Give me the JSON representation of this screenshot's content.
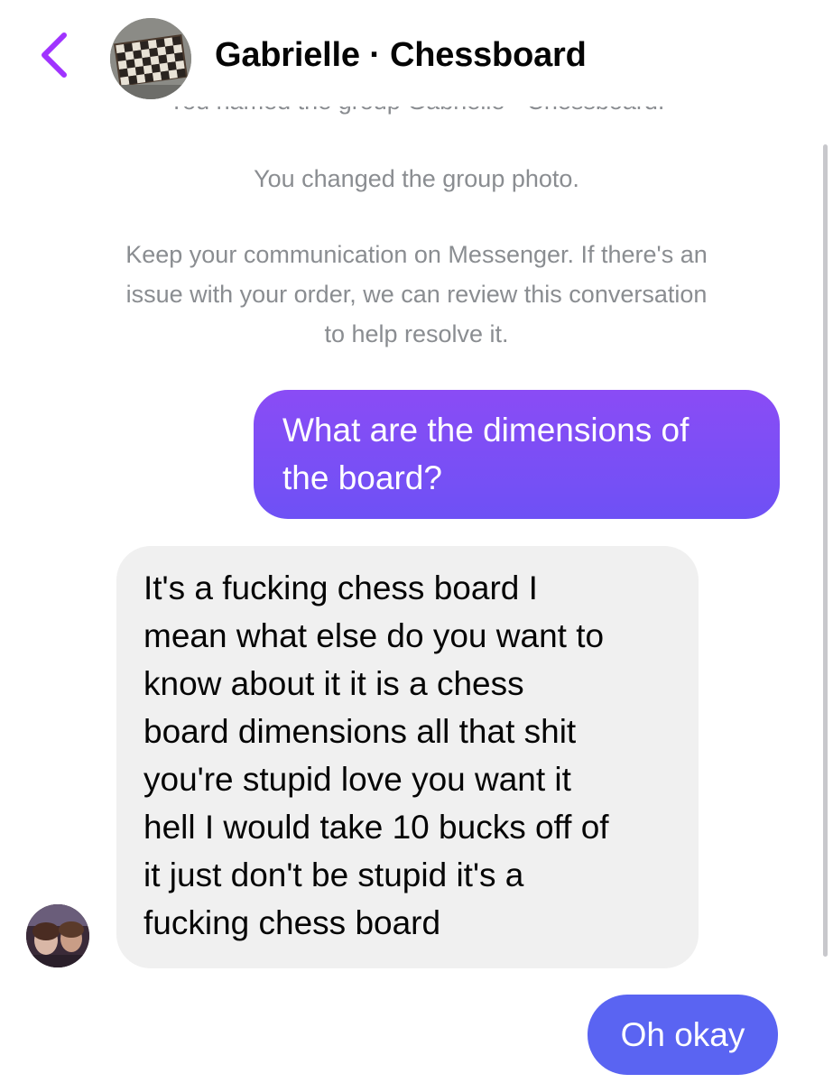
{
  "header": {
    "title": "Gabrielle · Chessboard",
    "back_icon": "chevron-left-icon",
    "avatar_icon": "chessboard-photo",
    "accent_color": "#a033ff"
  },
  "system_messages": {
    "clipped": "You named the group Gabrielle · Chessboard.",
    "photo_changed": "You changed the group photo.",
    "notice_line1": "Keep your communication on Messenger. If there's an",
    "notice_line2": "issue with your order, we can review this conversation",
    "notice_line3": "to help resolve it."
  },
  "messages": [
    {
      "direction": "outgoing",
      "lines": [
        "What are the dimensions of",
        "the board?"
      ]
    },
    {
      "direction": "incoming",
      "lines": [
        "It's a fucking chess board I",
        "mean what else do you want to",
        "know about it it is a chess",
        "board dimensions all that shit",
        "you're stupid love you want it",
        "hell I would take 10 bucks off of",
        "it just don't be stupid it's a",
        "fucking chess board"
      ]
    },
    {
      "direction": "outgoing",
      "lines": [
        "Oh okay"
      ]
    }
  ],
  "colors": {
    "outgoing_gradient_top": "#8a4cf5",
    "outgoing_gradient_bottom": "#6e51f5",
    "outgoing_solid": "#5a64f2",
    "incoming_bg": "#f0f0f0",
    "system_text": "#8a8d91"
  }
}
